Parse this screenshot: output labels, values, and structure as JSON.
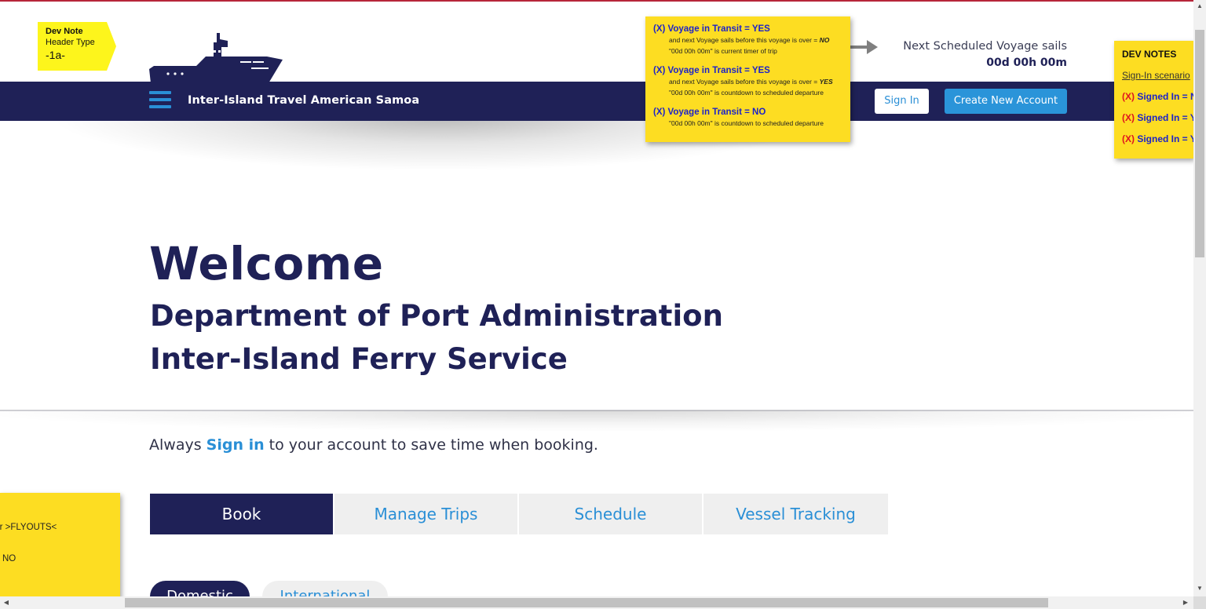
{
  "header": {
    "brand_title": "Inter-Island Travel American Samoa",
    "signin_label": "Sign In",
    "create_account_label": "Create New Account",
    "next_voyage_label": "Next Scheduled Voyage sails",
    "next_voyage_time": "00d 00h 00m",
    "icons": [
      "ship-logo-icon",
      "hamburger-menu-icon",
      "arrow-right-icon"
    ]
  },
  "dev_note_tag": {
    "title": "Dev Note",
    "line2": "Header Type",
    "line3": "-1a-"
  },
  "voyage_notes": [
    {
      "prefix": "(X)",
      "heading": "Voyage in Transit = YES",
      "line1_pre": "and next Voyage sails before this voyage is over = ",
      "line1_em": "NO",
      "line2": "\"00d 00h 00m\" is current timer of trip"
    },
    {
      "prefix": "(X)",
      "heading": "Voyage in Transit = YES",
      "line1_pre": "and next Voyage sails before this voyage is over = ",
      "line1_em": "YES",
      "line2": "\"00d 00h 00m\" is countdown to scheduled departure"
    },
    {
      "prefix": "(X)",
      "heading": "Voyage in Transit = NO",
      "line2": "\"00d 00h 00m\" is countdown to scheduled departure"
    }
  ],
  "dev_notes_panel": {
    "title": "DEV NOTES",
    "link": "Sign-In scenario",
    "rows": [
      {
        "prefix": "(X)",
        "text": "Signed In = N"
      },
      {
        "prefix": "(X)",
        "text": "Signed In = Y"
      },
      {
        "prefix": "(X)",
        "text": "Signed In = Y"
      }
    ]
  },
  "flyout_note": {
    "line1": "for >FLYOUTS<",
    "line2": "NO"
  },
  "hero": {
    "welcome": "Welcome",
    "line1": "Department of Port Administration",
    "line2": "Inter-Island Ferry Service"
  },
  "signin_prompt": {
    "before": "Always ",
    "link": "Sign in",
    "after": " to your account to save time when booking."
  },
  "tabs": [
    {
      "label": "Book",
      "active": true
    },
    {
      "label": "Manage Trips",
      "active": false
    },
    {
      "label": "Schedule",
      "active": false
    },
    {
      "label": "Vessel Tracking",
      "active": false
    }
  ],
  "trip_type": {
    "domestic": "Domestic",
    "international": "International",
    "selected": "Domestic"
  },
  "colors": {
    "navy": "#1f2157",
    "accent_blue": "#2a94d9",
    "note_yellow": "#fddd22",
    "tag_yellow": "#fdf51c",
    "note_blue_text": "#1d23c8",
    "note_red_text": "#e0141e"
  }
}
